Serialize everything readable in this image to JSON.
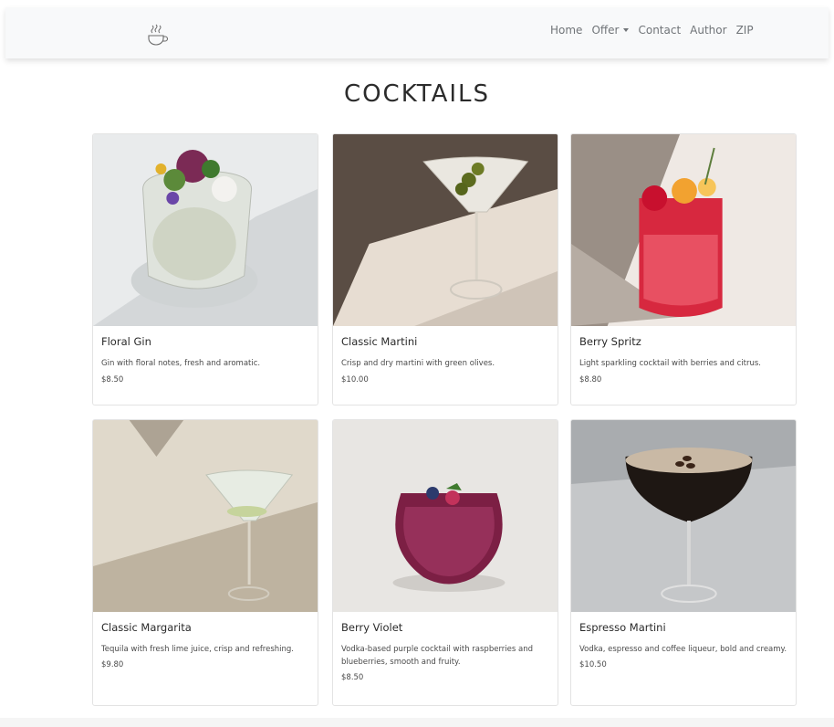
{
  "nav": {
    "links": [
      {
        "label": "Home"
      },
      {
        "label": "Offer",
        "dropdown": true
      },
      {
        "label": "Contact"
      },
      {
        "label": "Author"
      },
      {
        "label": "ZIP"
      }
    ],
    "brand_icon": "coffee-cup-icon"
  },
  "page": {
    "title": "COCKTAILS"
  },
  "cards": [
    {
      "name": "Floral Gin",
      "description": "Gin with floral notes, fresh and aromatic.",
      "price": "$8.50"
    },
    {
      "name": "Classic Martini",
      "description": "Crisp and dry martini with green olives.",
      "price": "$10.00"
    },
    {
      "name": "Berry Spritz",
      "description": "Light sparkling cocktail with berries and citrus.",
      "price": "$8.80"
    },
    {
      "name": "Classic Margarita",
      "description": "Tequila with fresh lime juice, crisp and refreshing.",
      "price": "$9.80"
    },
    {
      "name": "Berry Violet",
      "description": "Vodka-based purple cocktail with raspberries and blueberries, smooth and fruity.",
      "price": "$8.50"
    },
    {
      "name": "Espresso Martini",
      "description": "Vodka, espresso and coffee liqueur, bold and creamy.",
      "price": "$10.50"
    }
  ]
}
